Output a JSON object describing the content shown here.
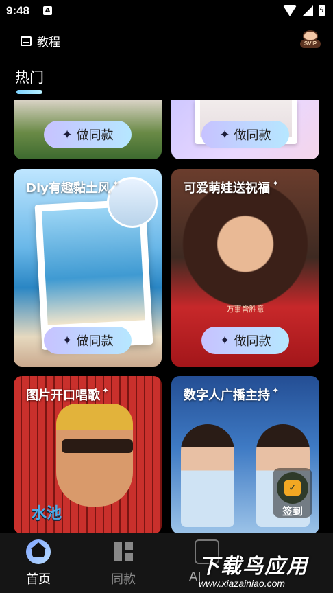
{
  "status_bar": {
    "time": "9:48",
    "notification_icon": "A"
  },
  "header": {
    "tutorial_label": "教程",
    "svip_label": "SVIP"
  },
  "section": {
    "title": "热门"
  },
  "cards": [
    {
      "title": "",
      "button": "做同款"
    },
    {
      "title": "",
      "button": "做同款"
    },
    {
      "title": "Diy有趣黏土风",
      "button": "做同款"
    },
    {
      "title": "可爱萌娃送祝福",
      "button": "做同款",
      "caption": "万事皆胜意"
    },
    {
      "title": "图片开口唱歌",
      "overlay_text": "水池"
    },
    {
      "title": "数字人广播主持"
    }
  ],
  "floating": {
    "signin_label": "签到"
  },
  "bottom_nav": [
    {
      "label": "首页",
      "active": true
    },
    {
      "label": "同款",
      "active": false
    },
    {
      "label": "AI",
      "active": false
    }
  ],
  "watermark": {
    "big": "下载鸟应用",
    "small": "www.xiazainiao.com"
  },
  "colors": {
    "accent": "#9bb9ff",
    "button_gradient_start": "#c7c2ff",
    "button_gradient_end": "#b6e7ff"
  }
}
